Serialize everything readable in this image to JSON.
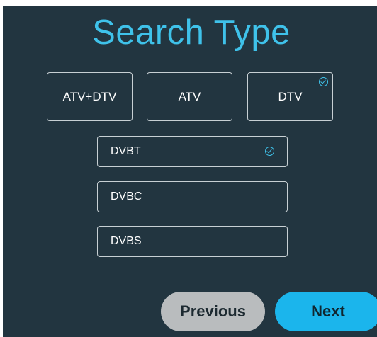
{
  "title": "Search Type",
  "accent_color": "#3fc2ea",
  "background_color": "#223540",
  "search_types": [
    {
      "label": "ATV+DTV",
      "selected": false
    },
    {
      "label": "ATV",
      "selected": false
    },
    {
      "label": "DTV",
      "selected": true,
      "icon": "check-circle-icon"
    }
  ],
  "dtv_standards": [
    {
      "label": "DVBT",
      "selected": true,
      "icon": "check-circle-icon"
    },
    {
      "label": "DVBC",
      "selected": false
    },
    {
      "label": "DVBS",
      "selected": false
    }
  ],
  "buttons": {
    "previous": "Previous",
    "next": "Next"
  }
}
